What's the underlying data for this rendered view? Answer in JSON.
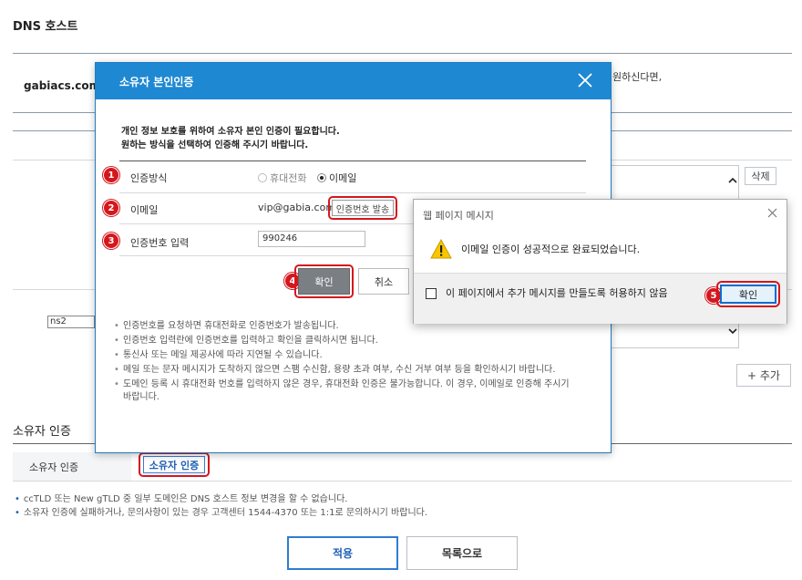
{
  "page": {
    "title": "DNS 호스트",
    "domain": "gabiacs.com",
    "ghost_text": "원하신다면,",
    "delete_button": "삭제",
    "ns_value": "ns2",
    "add_button": "+ 추가",
    "owner_section_title": "소유자 인증",
    "owner_row_label": "소유자 인증",
    "owner_button": "소유자 인증",
    "notes": [
      "ccTLD 또는 New gTLD 중 일부 도메인은 DNS 호스트 정보 변경을 할 수 없습니다.",
      "소유자 인증에 실패하거나, 문의사항이 있는 경우 고객센터 1544-4370 또는 1:1로 문의하시기 바랍니다."
    ],
    "apply_button": "적용",
    "list_button": "목록으로"
  },
  "modal": {
    "title": "소유자 본인인증",
    "intro_line1": "개인 정보 보호를 위하여 소유자 본인 인증이 필요합니다.",
    "intro_line2": "원하는 방식을 선택하여 인증해 주시기 바랍니다.",
    "method_label": "인증방식",
    "method_options": [
      "휴대전화",
      "이메일"
    ],
    "method_selected": "이메일",
    "email_label": "이메일",
    "email_value": "vip@gabia.com",
    "send_code_button": "인증번호 발송",
    "code_label": "인증번호 입력",
    "code_value": "990246",
    "confirm_button": "확인",
    "cancel_button": "취소",
    "info": [
      "인증번호를 요청하면 휴대전화로 인증번호가 발송됩니다.",
      "인증번호 입력란에 인증번호를 입력하고 확인을 클릭하시면 됩니다.",
      "통신사 또는 메일 제공사에 따라 지연될 수 있습니다.",
      "메일 또는 문자 메시지가 도착하지 않으면 스팸 수신함, 용량 초과 여부, 수신 거부 여부 등을 확인하시기 바랍니다.",
      "도메인 등록 시 휴대전화 번호를 입력하지 않은 경우, 휴대전화 인증은 불가능합니다. 이 경우, 이메일로 인증해 주시기 바랍니다."
    ]
  },
  "steps": [
    "1",
    "2",
    "3",
    "4",
    "5"
  ],
  "dialog": {
    "title": "웹 페이지 메시지",
    "message": "이메일 인증이 성공적으로 완료되었습니다.",
    "checkbox_label": "이 페이지에서 추가 메시지를 만들도록 허용하지 않음",
    "ok_button": "확인"
  },
  "colors": {
    "accent": "#1e88d2",
    "highlight": "#d4171d",
    "link_blue": "#1e5fb4",
    "confirm_gray": "#7a7f84"
  },
  "icons": [
    "close-icon",
    "warning-icon",
    "chevron-up-icon",
    "chevron-down-icon"
  ]
}
